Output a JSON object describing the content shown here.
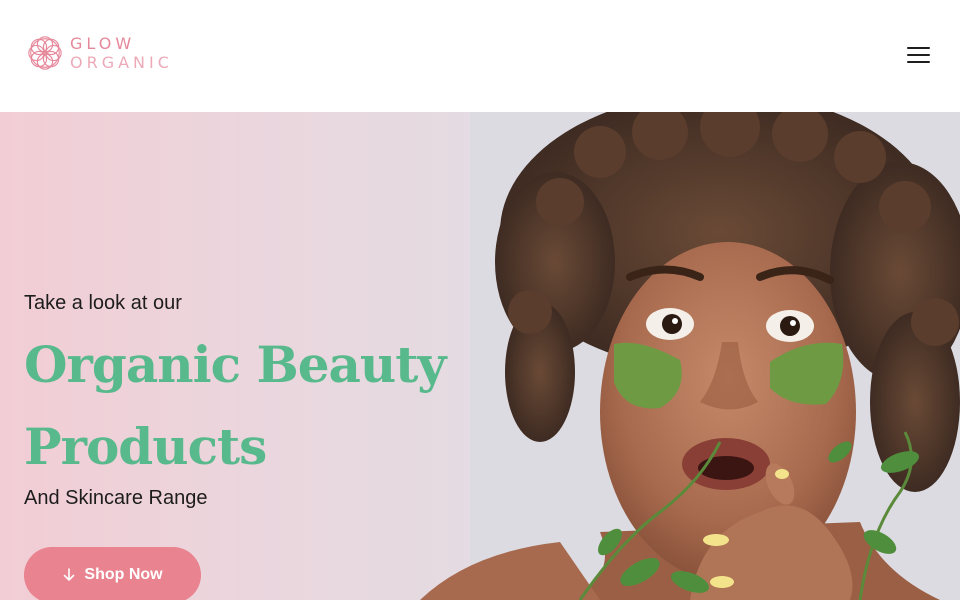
{
  "brand": {
    "line1": "GLOW",
    "line2": "ORGANIC",
    "accent": "#e6889b"
  },
  "header": {
    "menu_icon": "hamburger-menu-icon"
  },
  "hero": {
    "eyebrow": "Take a look at our",
    "headline": "Organic Beauty Products",
    "subline": "And Skincare Range",
    "cta": {
      "label": "Shop Now",
      "icon": "arrow-down-icon",
      "color": "#e8838f"
    },
    "headline_color": "#58b98d"
  }
}
